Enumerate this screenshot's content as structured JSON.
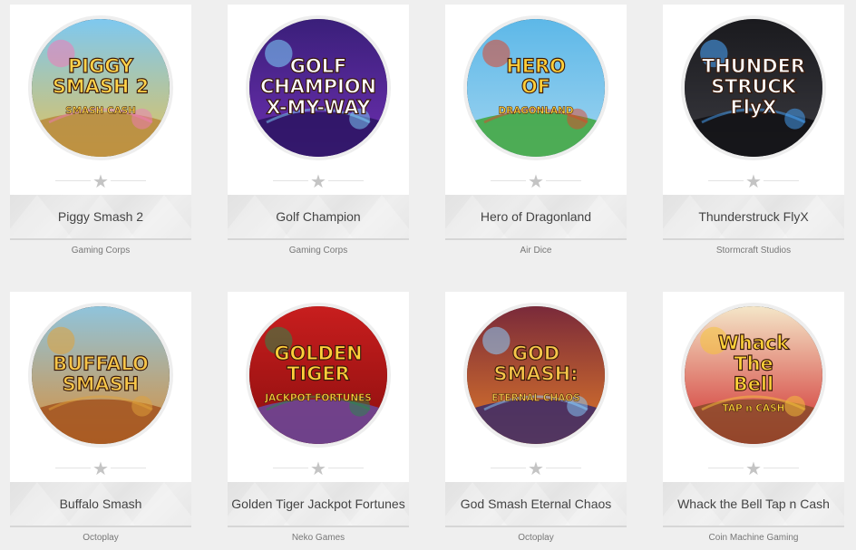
{
  "games": [
    {
      "title": "Piggy Smash 2",
      "provider": "Gaming Corps",
      "logo_lines": [
        "PIGGY",
        "SMASH 2",
        "SMASH CASH"
      ],
      "art": {
        "bg1": "#7ec8f0",
        "bg2": "#e2c25a",
        "ground": "#b88a3c",
        "accent": "#f07ab8",
        "text": "#ffd34a"
      }
    },
    {
      "title": "Golf Champion",
      "provider": "Gaming Corps",
      "logo_lines": [
        "GOLF",
        "CHAMPION",
        "X-MY-WAY"
      ],
      "art": {
        "bg1": "#3a1f7a",
        "bg2": "#6d2fb0",
        "ground": "#2a1460",
        "accent": "#7fd6ff",
        "text": "#ffffff"
      }
    },
    {
      "title": "Hero of Dragonland",
      "provider": "Air Dice",
      "logo_lines": [
        "HERO",
        "OF",
        "DRAGONLAND"
      ],
      "art": {
        "bg1": "#5db8e8",
        "bg2": "#9fd4f0",
        "ground": "#3fa63a",
        "accent": "#e0462a",
        "text": "#ffcf3a"
      }
    },
    {
      "title": "Thunderstruck FlyX",
      "provider": "Stormcraft Studios",
      "logo_lines": [
        "THUNDER",
        "STRUCK",
        "FlyX"
      ],
      "art": {
        "bg1": "#1a1a1e",
        "bg2": "#3a3a40",
        "ground": "#111114",
        "accent": "#4aa8ff",
        "text": "#ffffff"
      }
    },
    {
      "title": "Buffalo Smash",
      "provider": "Octoplay",
      "logo_lines": [
        "BUFFALO",
        "SMASH"
      ],
      "art": {
        "bg1": "#8fc4dc",
        "bg2": "#d98f3a",
        "ground": "#a2521e",
        "accent": "#e0a23a",
        "text": "#f6c64a"
      }
    },
    {
      "title": "Golden Tiger Jackpot Fortunes",
      "provider": "Neko Games",
      "logo_lines": [
        "GOLDEN",
        "TIGER",
        "JACKPOT FORTUNES"
      ],
      "art": {
        "bg1": "#c81e1e",
        "bg2": "#8a0e0e",
        "ground": "#6a4aa0",
        "accent": "#2a8a4a",
        "text": "#ffcf3a"
      }
    },
    {
      "title": "God Smash Eternal Chaos",
      "provider": "Octoplay",
      "logo_lines": [
        "GOD",
        "SMASH:",
        "ETERNAL CHAOS"
      ],
      "art": {
        "bg1": "#7a2a3a",
        "bg2": "#e07a2a",
        "ground": "#3a2a6a",
        "accent": "#8ad0ff",
        "text": "#f6c64a"
      }
    },
    {
      "title": "Whack the Bell Tap n Cash",
      "provider": "Coin Machine Gaming",
      "logo_lines": [
        "Whack",
        "The",
        "Bell",
        "TAP n CASH"
      ],
      "art": {
        "bg1": "#f4e6c8",
        "bg2": "#d02a2a",
        "ground": "#8a4a2a",
        "accent": "#f6c23a",
        "text": "#ffd23a"
      }
    }
  ],
  "star_glyph": "★"
}
